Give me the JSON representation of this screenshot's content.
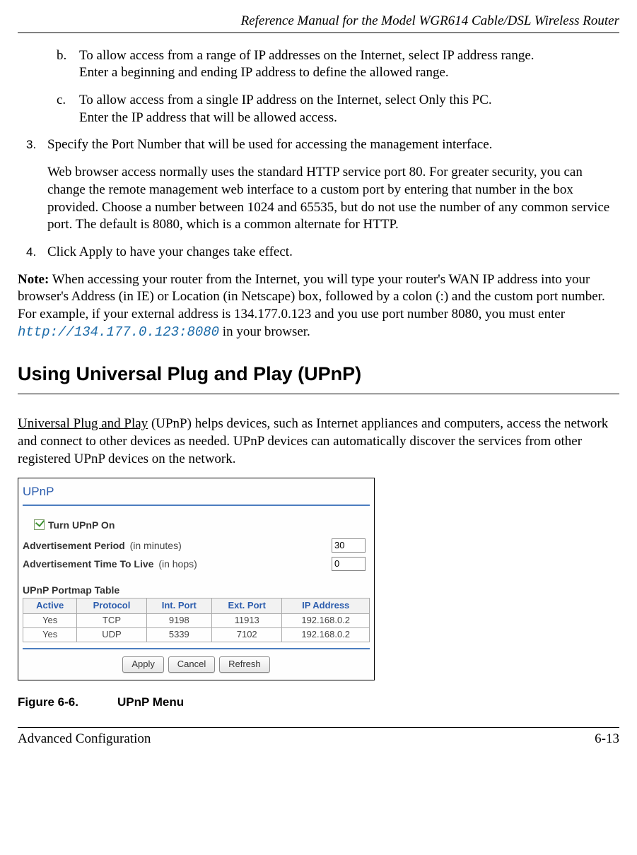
{
  "header": {
    "title": "Reference Manual for the Model WGR614 Cable/DSL Wireless Router"
  },
  "items": {
    "b": {
      "marker": "b.",
      "line1": "To allow access from a range of IP addresses on the Internet, select IP address range.",
      "line2": "Enter a beginning and ending IP address to define the allowed range."
    },
    "c": {
      "marker": "c.",
      "line1": "To allow access from a single IP address on the Internet, select Only this PC.",
      "line2": "Enter the IP address that will be allowed access."
    },
    "three": {
      "num": "3.",
      "text": "Specify the Port Number that will be used for accessing the management interface.",
      "cont": "Web browser access normally uses the standard HTTP service port 80. For greater security, you can change the remote management web interface to a custom port by entering that number in the box provided. Choose a number between 1024 and 65535, but do not use the number of any common service port. The default is 8080, which is a common alternate for HTTP."
    },
    "four": {
      "num": "4.",
      "text": "Click Apply to have your changes take effect."
    }
  },
  "note": {
    "label": "Note:",
    "pre": " When accessing your router from the Internet, you will type your router's WAN IP address into your browser's Address (in IE) or Location (in Netscape) box, followed by a colon (:) and the custom port number. For example, if your external address is 134.177.0.123 and you use port number 8080, you must enter ",
    "url": "http://134.177.0.123:8080",
    "post": " in your browser."
  },
  "section_heading": "Using Universal Plug and Play (UPnP)",
  "upnp_para": {
    "link": "Universal Plug and Play",
    "rest": " (UPnP) helps devices, such as Internet appliances and computers, access the network and connect to other devices as needed. UPnP devices can automatically discover the services from other registered UPnP devices on the network."
  },
  "menu": {
    "title": "UPnP",
    "checkbox_label": "Turn UPnP On",
    "adv_period": {
      "bold": "Advertisement Period",
      "rest": " (in minutes)",
      "value": "30"
    },
    "adv_ttl": {
      "bold": "Advertisement Time To Live",
      "rest": " (in hops)",
      "value": "0"
    },
    "table_label": "UPnP Portmap Table",
    "headers": {
      "active": "Active",
      "protocol": "Protocol",
      "intport": "Int. Port",
      "extport": "Ext. Port",
      "ip": "IP Address"
    },
    "rows": [
      {
        "active": "Yes",
        "protocol": "TCP",
        "intport": "9198",
        "extport": "11913",
        "ip": "192.168.0.2"
      },
      {
        "active": "Yes",
        "protocol": "UDP",
        "intport": "5339",
        "extport": "7102",
        "ip": "192.168.0.2"
      }
    ],
    "buttons": {
      "apply": "Apply",
      "cancel": "Cancel",
      "refresh": "Refresh"
    }
  },
  "figure": {
    "num": "Figure 6-6.",
    "title": "UPnP Menu"
  },
  "footer": {
    "left": "Advanced Configuration",
    "right": "6-13"
  }
}
